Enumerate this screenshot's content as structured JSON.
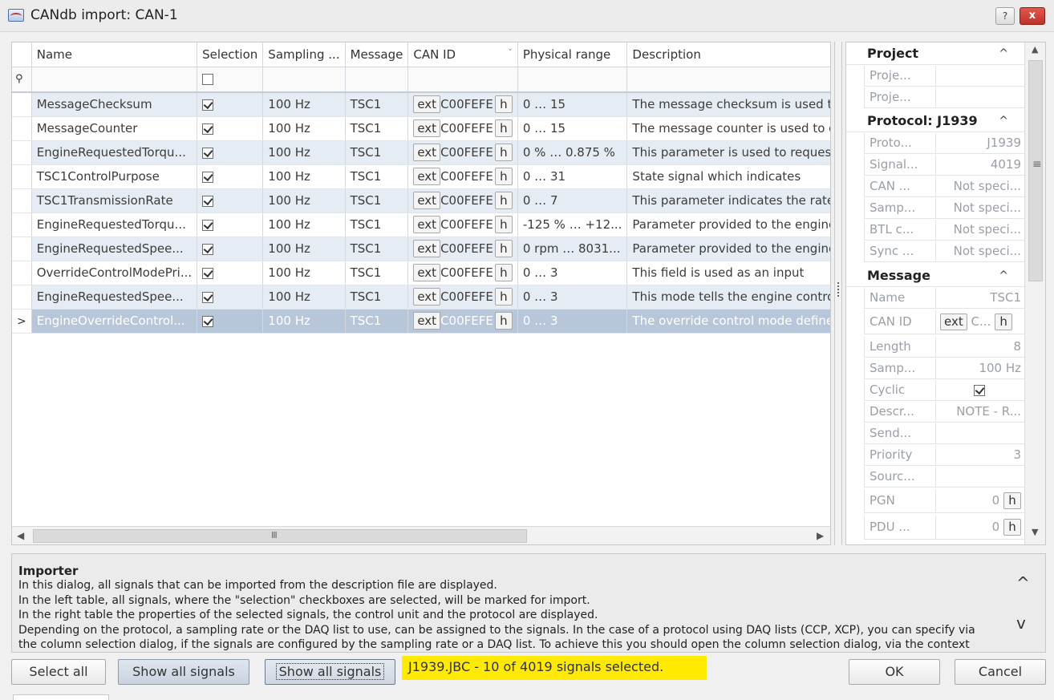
{
  "window": {
    "title": "CANdb import: CAN-1",
    "help": "?",
    "close": "x"
  },
  "grid": {
    "columns": [
      "Name",
      "Selection",
      "Sampling ...",
      "Message",
      "CAN ID",
      "Physical range",
      "Description"
    ],
    "sort_indicator": "˅",
    "filter_icon": "⚲",
    "selected_marker": ">",
    "rows": [
      {
        "name": "MessageChecksum",
        "selected": true,
        "sampling": "100 Hz",
        "message": "TSC1",
        "can_ext": "ext",
        "can_id": "C00FEFE",
        "can_h": "h",
        "range": "0 … 15",
        "description": "The message checksum is used to verify"
      },
      {
        "name": "MessageCounter",
        "selected": true,
        "sampling": "100 Hz",
        "message": "TSC1",
        "can_ext": "ext",
        "can_id": "C00FEFE",
        "can_h": "h",
        "range": "0 … 15",
        "description": "The message counter is used to detect"
      },
      {
        "name": "EngineRequestedTorqu...",
        "selected": true,
        "sampling": "100 Hz",
        "message": "TSC1",
        "can_ext": "ext",
        "can_id": "C00FEFE",
        "can_h": "h",
        "range": "0 % … 0.875 %",
        "description": "This parameter is used to request"
      },
      {
        "name": "TSC1ControlPurpose",
        "selected": true,
        "sampling": "100 Hz",
        "message": "TSC1",
        "can_ext": "ext",
        "can_id": "C00FEFE",
        "can_h": "h",
        "range": "0 … 31",
        "description": "State signal which indicates"
      },
      {
        "name": "TSC1TransmissionRate",
        "selected": true,
        "sampling": "100 Hz",
        "message": "TSC1",
        "can_ext": "ext",
        "can_id": "C00FEFE",
        "can_h": "h",
        "range": "0 … 7",
        "description": "This parameter indicates the rate"
      },
      {
        "name": "EngineRequestedTorqu...",
        "selected": true,
        "sampling": "100 Hz",
        "message": "TSC1",
        "can_ext": "ext",
        "can_id": "C00FEFE",
        "can_h": "h",
        "range": "-125 % … +12...",
        "description": "Parameter provided to the engine"
      },
      {
        "name": "EngineRequestedSpee...",
        "selected": true,
        "sampling": "100 Hz",
        "message": "TSC1",
        "can_ext": "ext",
        "can_id": "C00FEFE",
        "can_h": "h",
        "range": "0 rpm … 8031...",
        "description": "Parameter provided to the engine"
      },
      {
        "name": "OverrideControlModePri...",
        "selected": true,
        "sampling": "100 Hz",
        "message": "TSC1",
        "can_ext": "ext",
        "can_id": "C00FEFE",
        "can_h": "h",
        "range": "0 … 3",
        "description": "This field is used as an input"
      },
      {
        "name": "EngineRequestedSpee...",
        "selected": true,
        "sampling": "100 Hz",
        "message": "TSC1",
        "can_ext": "ext",
        "can_id": "C00FEFE",
        "can_h": "h",
        "range": "0 … 3",
        "description": "This mode tells the engine control"
      },
      {
        "name": "EngineOverrideControl...",
        "selected": true,
        "sampling": "100 Hz",
        "message": "TSC1",
        "can_ext": "ext",
        "can_id": "C00FEFE",
        "can_h": "h",
        "range": "0 … 3",
        "description": "The override control mode defines"
      }
    ],
    "hscroll": {
      "left": "◀",
      "grip": "III",
      "right": "▶"
    }
  },
  "properties": {
    "project": {
      "title": "Project",
      "chevron": "^",
      "rows": [
        {
          "k": "Proje...",
          "v": ""
        },
        {
          "k": "Proje...",
          "v": ""
        }
      ]
    },
    "protocol": {
      "title": "Protocol: J1939",
      "chevron": "^",
      "rows": [
        {
          "k": "Proto...",
          "v": "J1939"
        },
        {
          "k": "Signal...",
          "v": "4019"
        },
        {
          "k": "CAN ...",
          "v": "Not speci..."
        },
        {
          "k": "Samp...",
          "v": "Not speci..."
        },
        {
          "k": "BTL c...",
          "v": "Not speci..."
        },
        {
          "k": "Sync ...",
          "v": "Not speci..."
        }
      ]
    },
    "message": {
      "title": "Message",
      "chevron": "^",
      "name_k": "Name",
      "name_v": "TSC1",
      "canid_k": "CAN ID",
      "canid_ext": "ext",
      "canid_v": "C...",
      "canid_h": "h",
      "length_k": "Length",
      "length_v": "8",
      "samp_k": "Samp...",
      "samp_v": "100 Hz",
      "cyclic_k": "Cyclic",
      "descr_k": "Descr...",
      "descr_v": "NOTE - R...",
      "send_k": "Send...",
      "send_v": "",
      "priority_k": "Priority",
      "priority_v": "3",
      "sourc_k": "Sourc...",
      "sourc_v": "",
      "pgn_k": "PGN",
      "pgn_v": "0",
      "pgn_h": "h",
      "pdu_k": "PDU ...",
      "pdu_v": "0",
      "pdu_h": "h"
    },
    "vscroll": {
      "up": "▲",
      "grip": "≡",
      "down": "▼"
    }
  },
  "help": {
    "title": "Importer",
    "lines": [
      "In this dialog, all signals that can be imported from the description file are displayed.",
      "In the left table, all signals, where the \"selection\" checkboxes are selected, will be marked for import.",
      "In the right table the properties of the selected signals, the control unit and the protocol are displayed.",
      "Depending on the protocol, a sampling rate or the DAQ list to use, can be assigned to the signals. In the case of a protocol using DAQ lists (CCP, XCP), you can specify via",
      "the column selection dialog, if the signals are configured by the sampling rate or a DAQ list. To achieve this you should open the column selection dialog, via the context"
    ],
    "up": "^",
    "down": "v"
  },
  "footer": {
    "select_all": "Select all",
    "show_all_1": "Show all signals",
    "show_all_2": "Show all signals",
    "status": "J1939.JBC  -  10 of 4019 signals selected.",
    "status_color": "#ffea00",
    "ok": "OK",
    "cancel": "Cancel"
  }
}
